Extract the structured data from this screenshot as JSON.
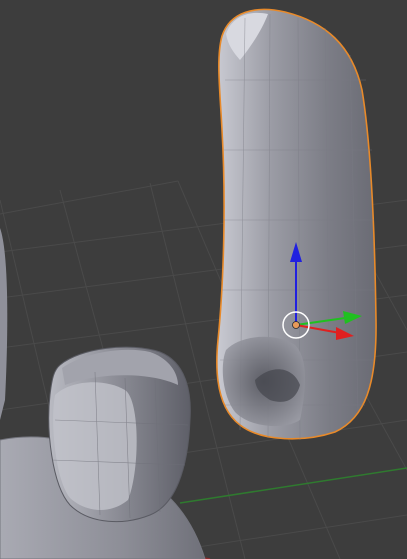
{
  "viewport": {
    "name": "3D Viewport",
    "background_color": "#3d3d3d",
    "grid_color": "#4a4a4a",
    "x_axis_color": "#8a2b2b",
    "y_axis_color": "#2f7a2f"
  },
  "scene": {
    "selected_object": {
      "outline_color": "#e88a2a",
      "origin_color": "#e89a5a"
    },
    "mesh_color": "#8e8f98"
  },
  "transform_gizmo": {
    "x_color": "#e02020",
    "y_color": "#20c020",
    "z_color": "#2020e0",
    "pivot_ring_color": "#ffffff"
  }
}
